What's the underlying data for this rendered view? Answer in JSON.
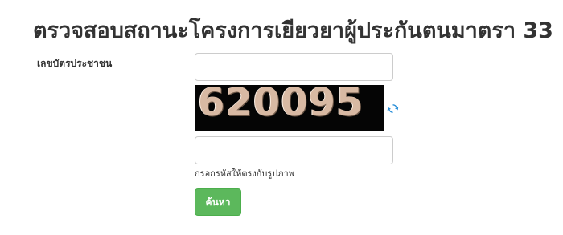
{
  "page": {
    "title": "ตรวจสอบสถานะโครงการเยียวยาผู้ประกันตนมาตรา 33"
  },
  "form": {
    "id_label": "เลขบัตรประชาชน",
    "id_value": "",
    "captcha_code": "620095",
    "captcha_value": "",
    "captcha_hint": "กรอกรหัสให้ตรงกับรูปภาพ",
    "search_label": "ค้นหา",
    "refresh_icon": "refresh-icon"
  },
  "colors": {
    "button_bg": "#5cb85c",
    "captcha_bg": "#050505",
    "captcha_digits": "#d8b9a3",
    "refresh_icon": "#2a8fd8"
  }
}
